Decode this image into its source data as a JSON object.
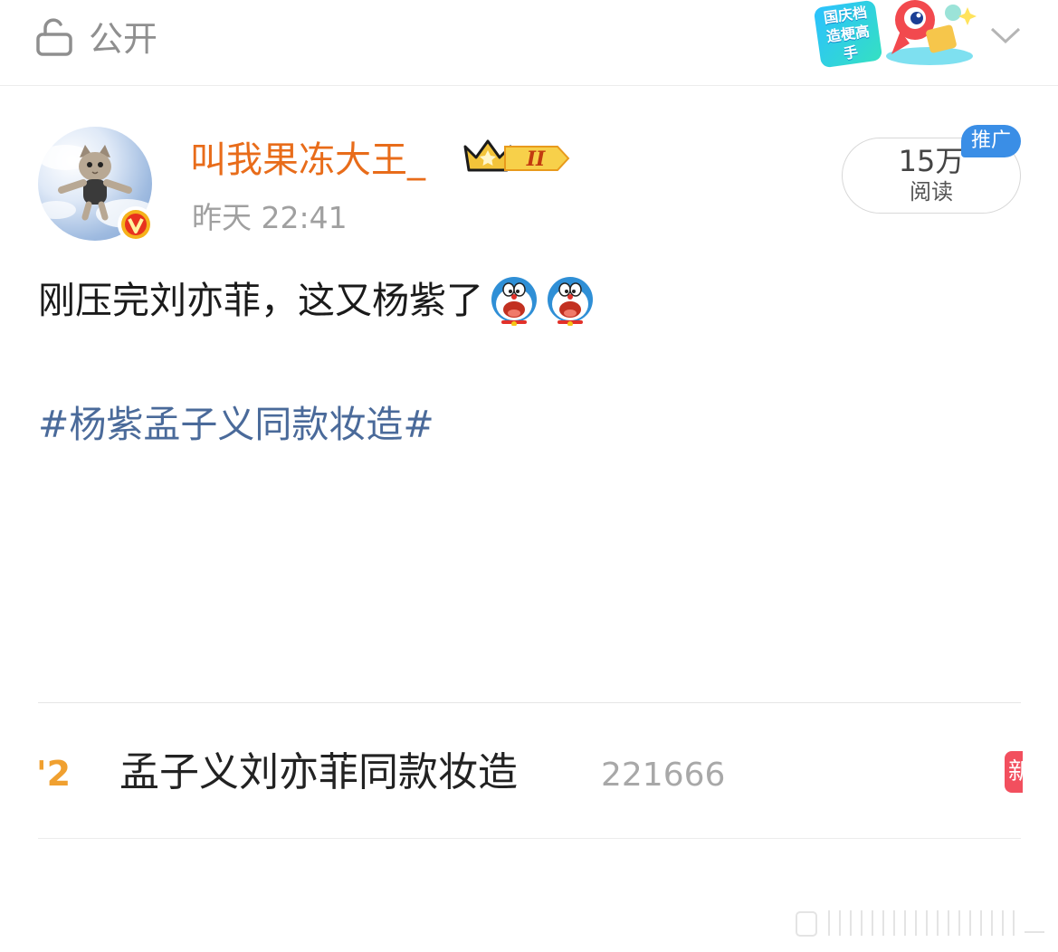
{
  "topbar": {
    "visibility_label": "公开",
    "festival_badge": "国庆档造梗高手"
  },
  "post": {
    "author": "叫我果冻大王_",
    "member_level": "II",
    "timestamp": "昨天 22:41",
    "reads_count": "15万",
    "reads_label": "阅读",
    "promo_label": "推广",
    "text": "刚压完刘亦菲，这又杨紫了",
    "emoji_names": [
      "doraemon-icon",
      "doraemon-icon"
    ],
    "hashtag": "#杨紫孟子义同款妆造#"
  },
  "trend": {
    "rank": "'2",
    "title": "孟子义刘亦菲同款妆造",
    "count": "221666",
    "badge": "新"
  },
  "colors": {
    "author": "#e86c1a",
    "hashtag": "#4a6a9a",
    "promo": "#3a8ee6",
    "rank": "#f0a030",
    "new_badge": "#f24f5e"
  }
}
